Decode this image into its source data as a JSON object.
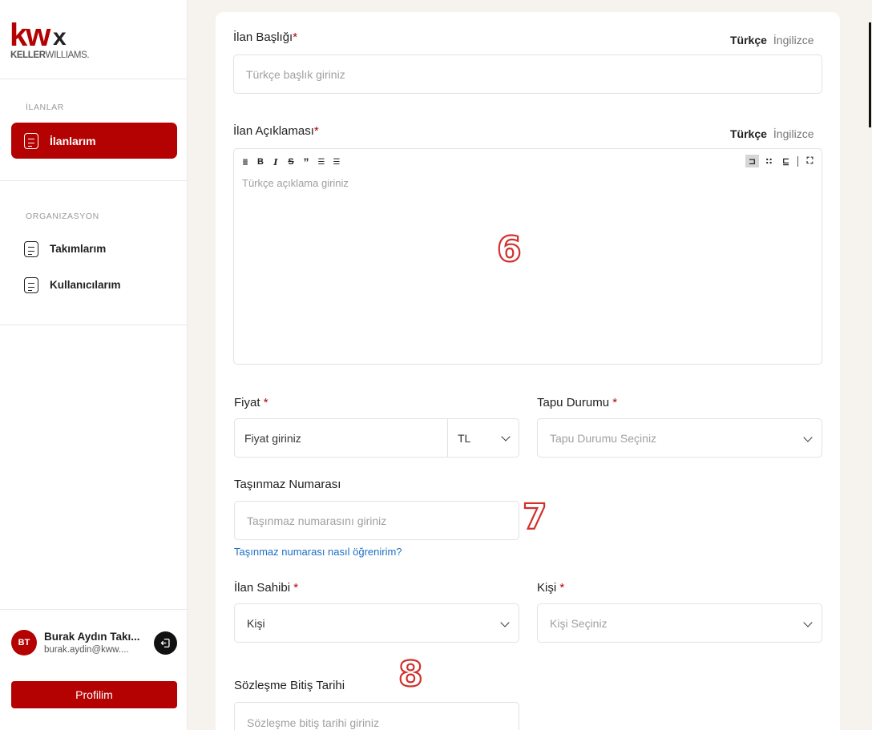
{
  "brand": {
    "logo_kw": "kw",
    "logo_x": "x",
    "logo_keller": "KELLER",
    "logo_williams": "WILLIAMS."
  },
  "sidebar": {
    "section_listings": "İLANLAR",
    "section_org": "ORGANIZASYON",
    "items": [
      {
        "label": "İlanlarım",
        "active": true
      },
      {
        "label": "Takımlarım",
        "active": false
      },
      {
        "label": "Kullanıcılarım",
        "active": false
      }
    ],
    "user": {
      "initials": "BT",
      "name": "Burak Aydın Takı...",
      "email": "burak.aydin@kww...."
    },
    "profile_button": "Profilim"
  },
  "form": {
    "title_label": "İlan Başlığı",
    "title_placeholder": "Türkçe başlık giriniz",
    "lang_on": "Türkçe",
    "lang_off": "İngilizce",
    "desc_label": "İlan Açıklaması",
    "desc_placeholder": "Türkçe açıklama giriniz",
    "price_label": "Fiyat",
    "price_placeholder": "Fiyat giriniz",
    "currency": "TL",
    "deed_label": "Tapu Durumu",
    "deed_placeholder": "Tapu Durumu Seçiniz",
    "property_no_label": "Taşınmaz Numarası",
    "property_no_placeholder": "Taşınmaz numarasını giriniz",
    "property_no_help": "Taşınmaz numarası nasıl öğrenirim?",
    "owner_label": "İlan Sahibi",
    "owner_value": "Kişi",
    "person_label": "Kişi",
    "person_placeholder": "Kişi Seçiniz",
    "contract_end_label": "Sözleşme Bitiş Tarihi",
    "contract_end_placeholder": "Sözleşme bitiş tarihi giriniz",
    "required_mark": "*"
  },
  "annotations": {
    "six": "6",
    "seven": "7",
    "eight": "8"
  },
  "colors": {
    "accent": "#b40101",
    "link": "#1f6fc5",
    "annotation": "#d0312d"
  }
}
